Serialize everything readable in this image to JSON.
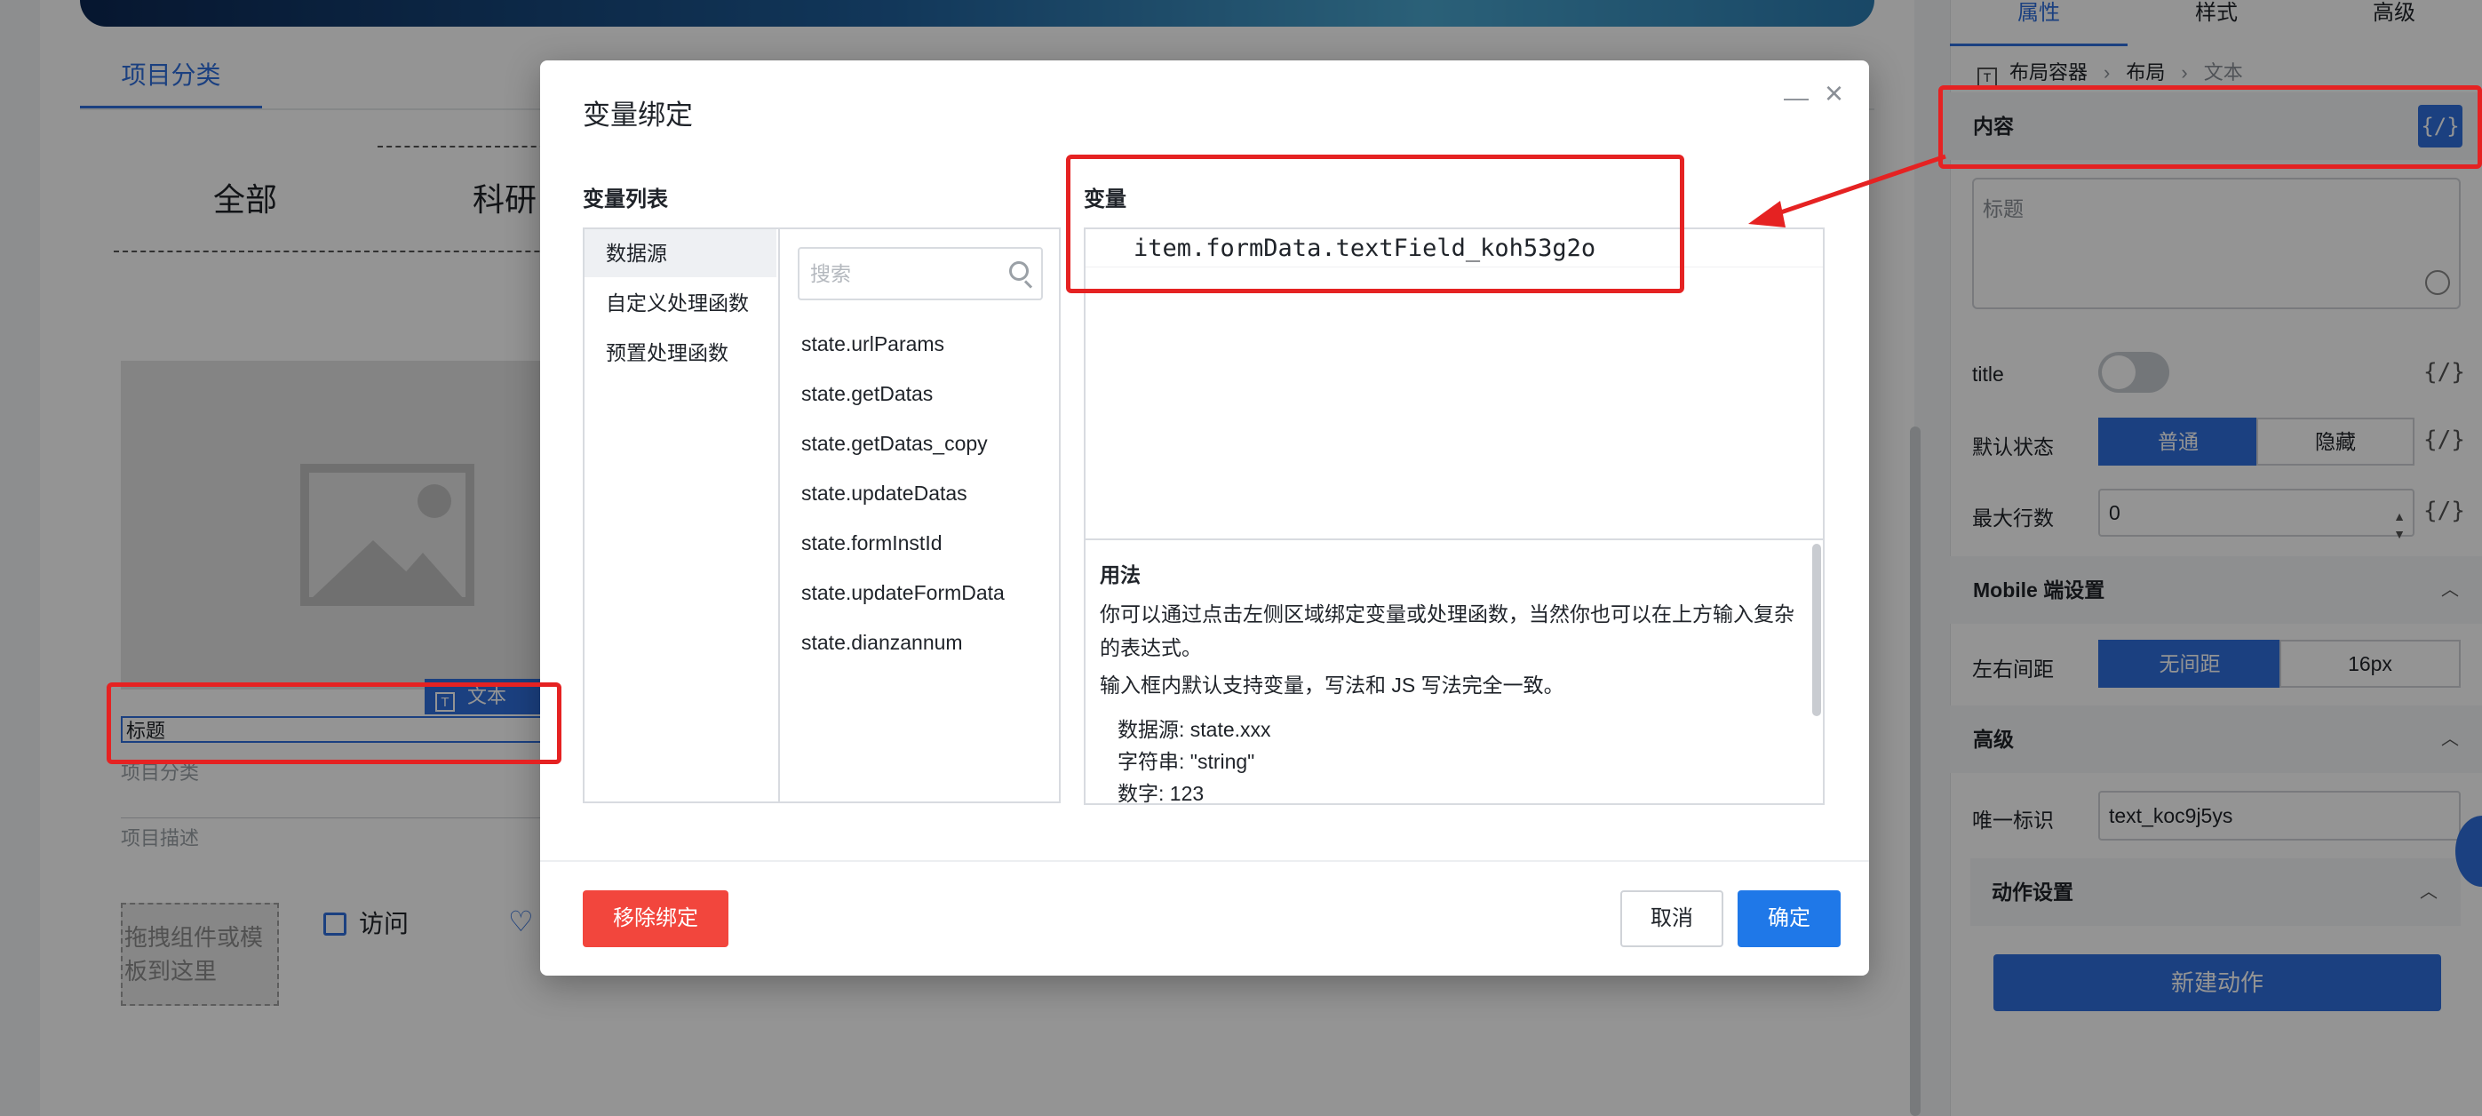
{
  "canvas": {
    "tab_active": "项目分类",
    "categories": [
      "全部",
      "科研"
    ],
    "text_chip": "文本",
    "title_value": "标题",
    "project_category": "项目分类",
    "project_desc": "项目描述",
    "drop_zone": "拖拽组件或模板到这里",
    "visit": "访问"
  },
  "panel": {
    "tabs": [
      "属性",
      "样式",
      "高级"
    ],
    "breadcrumb": [
      "布局容器",
      "布局",
      "文本"
    ],
    "content_section": "内容",
    "var_icon": "{/}",
    "content_placeholder": "标题",
    "title_label": "title",
    "default_state_label": "默认状态",
    "default_state_options": [
      "普通",
      "隐藏"
    ],
    "max_rows_label": "最大行数",
    "max_rows_value": "0",
    "mobile_section": "Mobile 端设置",
    "padding_label": "左右间距",
    "padding_options": [
      "无间距",
      "16px"
    ],
    "advanced_section": "高级",
    "unique_id_label": "唯一标识",
    "unique_id_value": "text_koc9j5ys",
    "action_section": "动作设置",
    "new_action": "新建动作"
  },
  "modal": {
    "title": "变量绑定",
    "var_list_label": "变量列表",
    "var_label": "变量",
    "categories": [
      "数据源",
      "自定义处理函数",
      "预置处理函数"
    ],
    "search_placeholder": "搜索",
    "variables": [
      "state.urlParams",
      "state.getDatas",
      "state.getDatas_copy",
      "state.updateDatas",
      "state.formInstId",
      "state.updateFormData",
      "state.dianzannum"
    ],
    "expression": "item.formData.textField_koh53g2o",
    "usage": {
      "title": "用法",
      "p1": "你可以通过点击左侧区域绑定变量或处理函数，当然你也可以在上方输入复杂的表达式。",
      "p2": "输入框内默认支持变量，写法和 JS 写法完全一致。",
      "lines": [
        "数据源: state.xxx",
        "字符串: \"string\"",
        "数字: 123"
      ]
    },
    "remove_btn": "移除绑定",
    "cancel_btn": "取消",
    "ok_btn": "确定"
  }
}
